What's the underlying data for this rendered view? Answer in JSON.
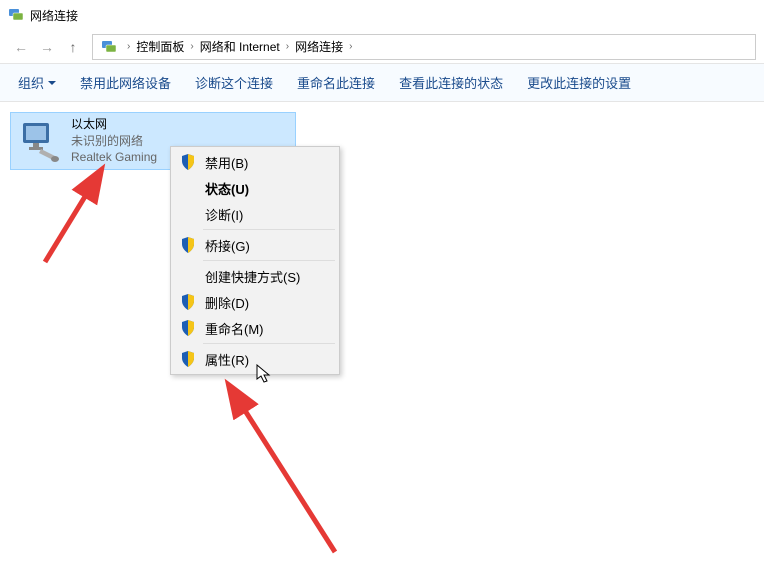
{
  "window": {
    "title": "网络连接"
  },
  "breadcrumb": {
    "items": [
      "控制面板",
      "网络和 Internet",
      "网络连接"
    ]
  },
  "toolbar": {
    "organize": "组织",
    "disable": "禁用此网络设备",
    "diagnose": "诊断这个连接",
    "rename": "重命名此连接",
    "status": "查看此连接的状态",
    "settings": "更改此连接的设置"
  },
  "adapter": {
    "name": "以太网",
    "status": "未识别的网络",
    "device": "Realtek Gaming"
  },
  "contextMenu": {
    "disable": "禁用(B)",
    "status": "状态(U)",
    "diagnose": "诊断(I)",
    "bridge": "桥接(G)",
    "shortcut": "创建快捷方式(S)",
    "delete": "删除(D)",
    "rename": "重命名(M)",
    "properties": "属性(R)"
  }
}
